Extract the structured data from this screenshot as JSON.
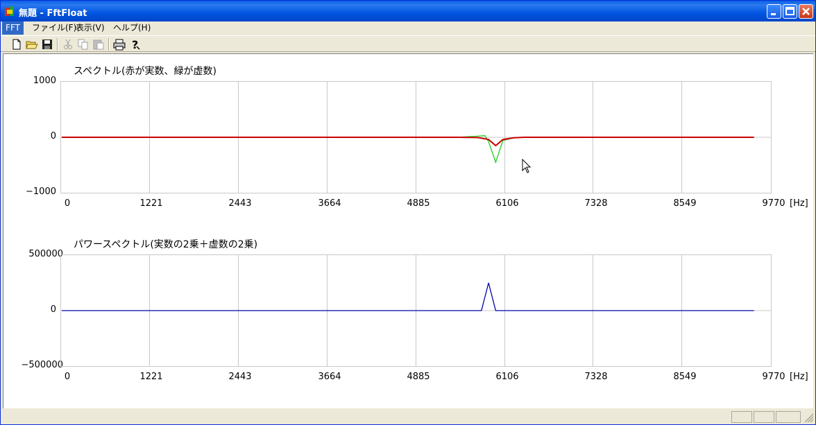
{
  "window": {
    "title": "無題 - FftFloat"
  },
  "menu": [
    "FFT",
    "ファイル(F)",
    "表示(V)",
    "ヘルプ(H)"
  ],
  "toolbar": [
    "new-file-icon",
    "open-folder-icon",
    "save-disk-icon",
    "cut-icon",
    "copy-icon",
    "paste-icon",
    "print-icon",
    "help-icon"
  ],
  "colors": {
    "real": "#cc0000",
    "imag": "#22cc22",
    "power": "#0000aa",
    "grid": "#c8c8c8"
  },
  "chart_data": [
    {
      "type": "line",
      "title": "スペクトル(赤が実数、緑が虚数)",
      "xlabel": "[Hz]",
      "x_ticks": [
        "0",
        "1221",
        "2443",
        "3664",
        "4885",
        "6106",
        "7328",
        "8549",
        "9770"
      ],
      "y_ticks": [
        "1000",
        "0",
        "−1000"
      ],
      "xlim": [
        0,
        9770
      ],
      "ylim": [
        -1000,
        1000
      ],
      "grid": true,
      "series": [
        {
          "color": "real",
          "x": [
            0,
            5500,
            5800,
            5950,
            6050,
            6150,
            6300,
            6450,
            9650
          ],
          "y": [
            0,
            0,
            -5,
            -40,
            -150,
            -40,
            -10,
            0,
            0
          ]
        },
        {
          "color": "imag",
          "x": [
            0,
            5500,
            5800,
            5900,
            5950,
            6050,
            6150,
            6300,
            6450,
            9650
          ],
          "y": [
            0,
            0,
            20,
            30,
            -80,
            -450,
            -60,
            -10,
            0,
            0
          ]
        }
      ]
    },
    {
      "type": "line",
      "title": "パワースペクトル(実数の2乗＋虚数の2乗)",
      "xlabel": "[Hz]",
      "x_ticks": [
        "0",
        "1221",
        "2443",
        "3664",
        "4885",
        "6106",
        "7328",
        "8549",
        "9770"
      ],
      "y_ticks": [
        "500000",
        "0",
        "−500000"
      ],
      "xlim": [
        0,
        9770
      ],
      "ylim": [
        -500000,
        500000
      ],
      "grid": true,
      "series": [
        {
          "color": "power",
          "x": [
            0,
            5850,
            5950,
            6050,
            9650
          ],
          "y": [
            0,
            0,
            250000,
            0,
            0
          ]
        }
      ]
    }
  ]
}
